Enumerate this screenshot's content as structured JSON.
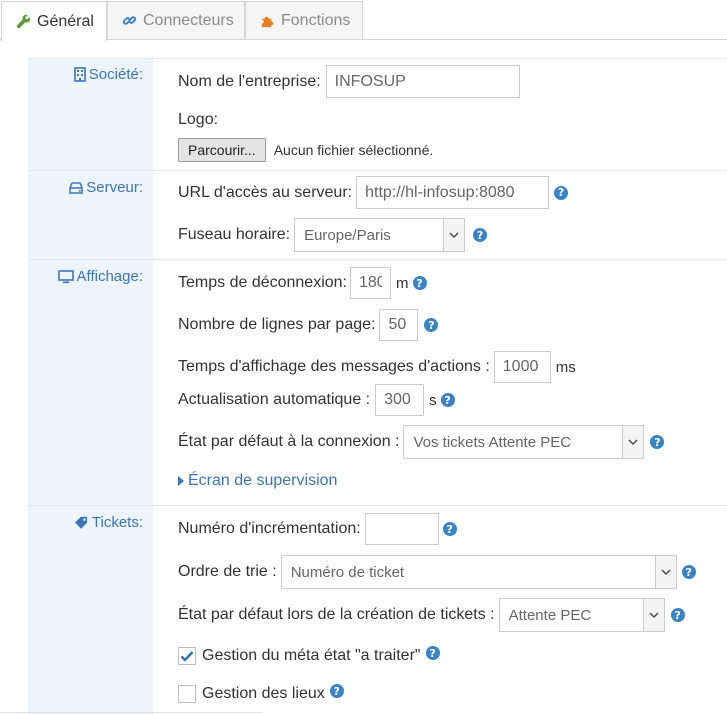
{
  "tabs": [
    {
      "label": "Général",
      "icon": "wrench-icon",
      "active": true
    },
    {
      "label": "Connecteurs",
      "icon": "link-icon",
      "active": false
    },
    {
      "label": "Fonctions",
      "icon": "puzzle-icon",
      "active": false
    }
  ],
  "sections": {
    "societe": {
      "label": "Société:",
      "company_name_label": "Nom de l'entreprise:",
      "company_name_value": "INFOSUP",
      "logo_label": "Logo:",
      "browse_button": "Parcourir...",
      "no_file_text": "Aucun fichier sélectionné."
    },
    "serveur": {
      "label": "Serveur:",
      "url_label": "URL d'accès au serveur:",
      "url_value": "http://hl-infosup:8080",
      "timezone_label": "Fuseau horaire:",
      "timezone_value": "Europe/Paris"
    },
    "affichage": {
      "label": "Affichage:",
      "logout_label": "Temps de déconnexion:",
      "logout_value": "180",
      "logout_unit": "m",
      "lines_label": "Nombre de lignes par page:",
      "lines_value": "50",
      "msg_label": "Temps d'affichage des messages d'actions :",
      "msg_value": "1000",
      "msg_unit": "ms",
      "refresh_label": "Actualisation automatique :",
      "refresh_value": "300",
      "refresh_unit": "s",
      "default_state_label": "État par défaut à la connexion :",
      "default_state_value": "Vos tickets Attente PEC",
      "supervision_link": "Écran de supervision"
    },
    "tickets": {
      "label": "Tickets:",
      "increment_label": "Numéro d'incrémentation:",
      "increment_value": "",
      "sort_label": "Ordre de trie :",
      "sort_value": "Numéro de ticket",
      "create_state_label": "État par défaut lors de la création de tickets :",
      "create_state_value": "Attente PEC",
      "meta_label": "Gestion du méta état \"a traiter\"",
      "meta_checked": true,
      "places_label": "Gestion des lieux",
      "places_checked": false
    }
  },
  "colors": {
    "accent": "#3a76b8",
    "help": "#3a83c4",
    "label_bg": "#eef4fb",
    "tab_icon_orange": "#e67e22",
    "wrench_green": "#5b9b3a"
  }
}
